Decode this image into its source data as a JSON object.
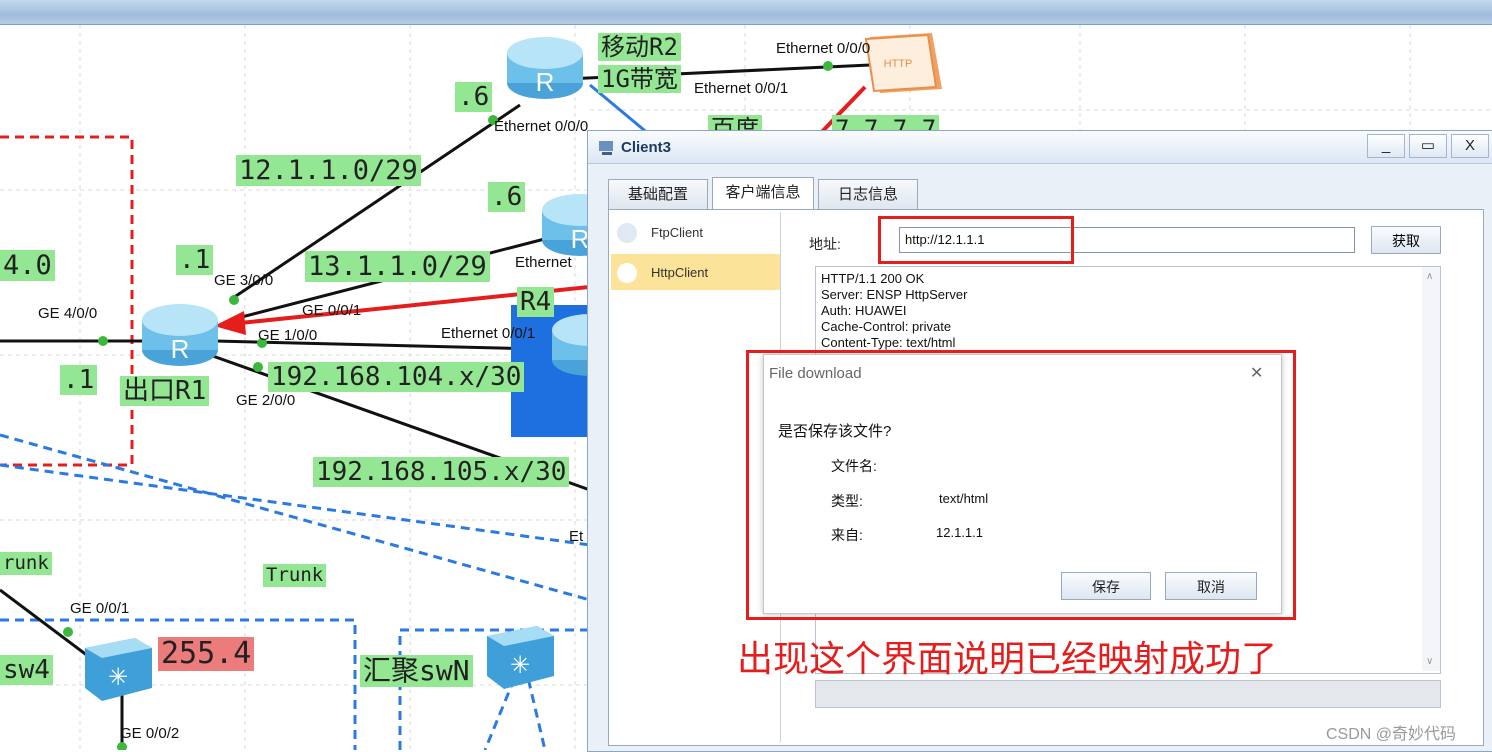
{
  "topology": {
    "router_r2_name": "移动R2",
    "router_r2_bw": "1G带宽",
    "r2_eth_000": "Ethernet 0/0/0",
    "r2_eth_001": "Ethernet 0/0/1",
    "r2_eth_000_b": "Ethernet 0/0/0",
    "http_server_eth": "Ethernet 0/0/0",
    "baidu_label": "百度",
    "baidu_ip": "7.7.7.7",
    "r2_dot6": ".6",
    "net_12": "12.1.1.0/29",
    "r3_dot6": ".6",
    "net_13": "13.1.1.0/29",
    "r3_eth": "Ethernet",
    "r1_dot1_top": ".1",
    "r1_ge300": "GE 3/0/0",
    "r1_ge001": "GE 0/0/1",
    "r1_ge400": "GE 4/0/0",
    "r1_ge100": "GE 1/0/0",
    "r1_ge200": "GE 2/0/0",
    "r1_dot1_left": ".1",
    "r1_name": "出口R1",
    "left_net": "4.0",
    "r4_name": "R4",
    "r4_eth": "Ethernet 0/0/1",
    "net_104": "192.168.104.x/30",
    "net_105": "192.168.105.x/30",
    "eth_cut": "Et",
    "trunk_left": "runk",
    "trunk_mid": "Trunk",
    "sw4_ge001": "GE 0/0/1",
    "sw4_ge002": "GE 0/0/2",
    "sw4_name": "sw4",
    "sw4_mask": "255.4",
    "swn_name": "汇聚swN"
  },
  "window": {
    "title": "Client3",
    "min": "_",
    "max": "▭",
    "close": "X",
    "tabs": [
      "基础配置",
      "客户端信息",
      "日志信息"
    ],
    "side_items": [
      "FtpClient",
      "HttpClient"
    ],
    "address_label": "地址:",
    "address_value": "http://12.1.1.1",
    "fetch_button": "获取",
    "response_lines": [
      "HTTP/1.1 200 OK",
      "Server: ENSP HttpServer",
      "Auth: HUAWEI",
      "Cache-Control: private",
      "Content-Type: text/html"
    ]
  },
  "dialog": {
    "title": "File download",
    "close": "✕",
    "question": "是否保存该文件?",
    "filename_label": "文件名:",
    "filename_value": "",
    "type_label": "类型:",
    "type_value": "text/html",
    "from_label": "来自:",
    "from_value": "12.1.1.1",
    "save_button": "保存",
    "cancel_button": "取消"
  },
  "annotation": "出现这个界面说明已经映射成功了",
  "watermark": "CSDN @奇妙代码",
  "colors": {
    "label_green": "#93e793",
    "label_red": "#ec7c7c",
    "annotation_red": "#e41d1d",
    "link_blue": "#2a7ae2"
  }
}
